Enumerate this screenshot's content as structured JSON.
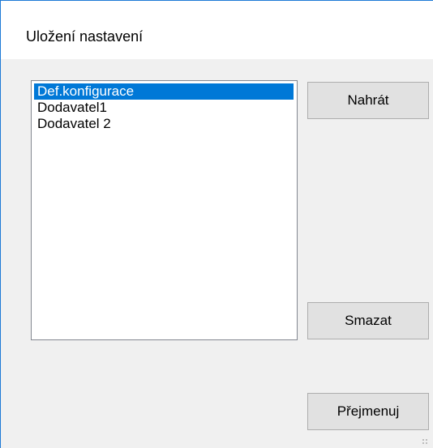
{
  "dialog": {
    "title": "Uložení nastavení"
  },
  "list": {
    "items": [
      {
        "label": "Def.konfigurace",
        "selected": true
      },
      {
        "label": "Dodavatel1",
        "selected": false
      },
      {
        "label": "Dodavatel 2",
        "selected": false
      }
    ]
  },
  "buttons": {
    "load_label": "Nahrát",
    "delete_label": "Smazat",
    "rename_label": "Přejmenuj"
  },
  "colors": {
    "accent": "#0078d7",
    "window_border": "#1e7ad6",
    "dialog_background": "#f0f0f0",
    "button_face": "#e1e1e1"
  }
}
